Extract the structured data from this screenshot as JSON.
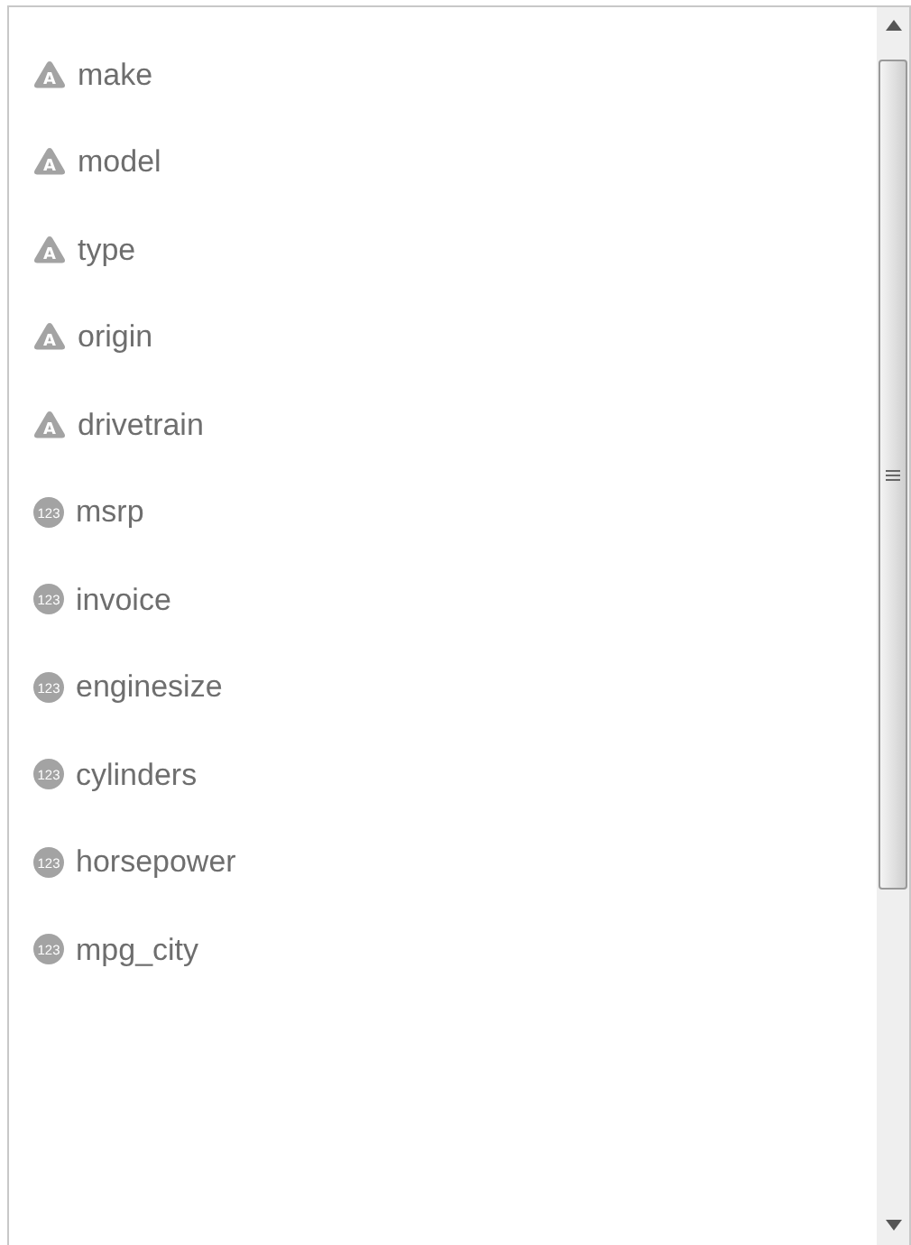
{
  "fields": [
    {
      "kind": "text",
      "badge": "A",
      "name": "make"
    },
    {
      "kind": "text",
      "badge": "A",
      "name": "model"
    },
    {
      "kind": "text",
      "badge": "A",
      "name": "type"
    },
    {
      "kind": "text",
      "badge": "A",
      "name": "origin"
    },
    {
      "kind": "text",
      "badge": "A",
      "name": "drivetrain"
    },
    {
      "kind": "number",
      "badge": "123",
      "name": "msrp"
    },
    {
      "kind": "number",
      "badge": "123",
      "name": "invoice"
    },
    {
      "kind": "number",
      "badge": "123",
      "name": "enginesize"
    },
    {
      "kind": "number",
      "badge": "123",
      "name": "cylinders"
    },
    {
      "kind": "number",
      "badge": "123",
      "name": "horsepower"
    },
    {
      "kind": "number",
      "badge": "123",
      "name": "mpg_city"
    }
  ]
}
